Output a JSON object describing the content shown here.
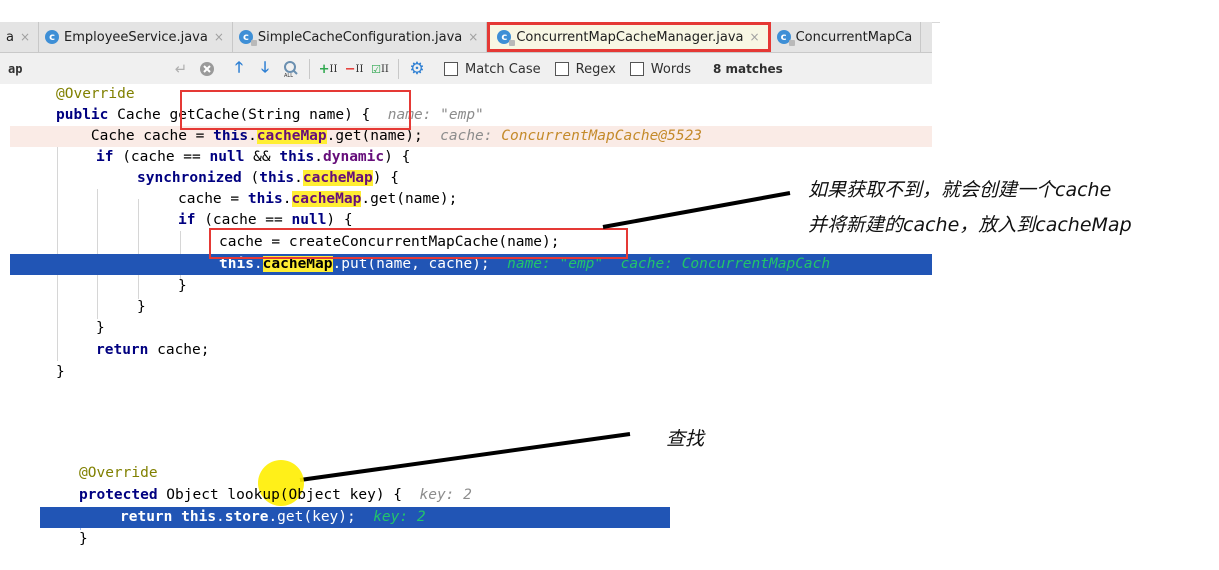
{
  "editor": {
    "tabs": [
      {
        "label": "a",
        "icon": "class-icon",
        "active": false
      },
      {
        "label": "EmployeeService.java",
        "icon": "class-icon",
        "active": false
      },
      {
        "label": "SimpleCacheConfiguration.java",
        "icon": "locked-class-icon",
        "active": false
      },
      {
        "label": "ConcurrentMapCacheManager.java",
        "icon": "locked-class-icon",
        "active": true
      },
      {
        "label": "ConcurrentMapCa",
        "icon": "locked-class-icon",
        "active": false
      }
    ],
    "close_glyph": "×",
    "find": {
      "query": "ap",
      "match_case_label": "Match Case",
      "regex_label": "Regex",
      "words_label": "Words",
      "match_count": "8 matches",
      "icons": [
        "enter-icon",
        "clear-icon",
        "prev-occurrence-icon",
        "next-occurrence-icon",
        "select-all-occurrences-icon",
        "add-selection-icon",
        "remove-selection-icon",
        "select-all-selection-icon",
        "settings-icon"
      ]
    },
    "code1": {
      "l1": "@Override",
      "l2_kw": "public",
      "l2_type": " Cache ",
      "l2_sig": "getCache(String name)",
      "l2_rest": " {  ",
      "l2_hint": "name: \"emp\"",
      "l3_a": "    Cache cache = ",
      "l3_this": "this",
      "l3_dot": ".",
      "l3_field": "cacheMap",
      "l3_b": ".get(name);  ",
      "l3_hint_label": "cache: ",
      "l3_hint_value": "ConcurrentMapCache@5523",
      "l4_if": "if",
      "l4_a": " (cache == ",
      "l4_null": "null",
      "l4_b": " && ",
      "l4_this": "this",
      "l4_field": "dynamic",
      "l4_c": ") {",
      "l5_sync": "synchronized",
      "l5_a": " (",
      "l5_this": "this",
      "l5_field": "cacheMap",
      "l5_b": ") {",
      "l6_a": "cache = ",
      "l6_this": "this",
      "l6_field": "cacheMap",
      "l6_b": ".get(name);",
      "l7_if": "if",
      "l7_a": " (cache == ",
      "l7_null": "null",
      "l7_b": ") {",
      "l8": "cache = createConcurrentMapCache(name);",
      "l9_this": "this",
      "l9_field": "cacheMap",
      "l9_a": ".put(name, cache);  ",
      "l9_hint": "name: \"emp\"  cache: ConcurrentMapCach",
      "brace": "}",
      "ret_kw": "return",
      "ret_rest": " cache;"
    },
    "code2": {
      "l1": "@Override",
      "l2_kw": "protected",
      "l2_a": " Object lookup(Object key) {  ",
      "l2_hint": "key: 2",
      "l3_ret": "return",
      "l3_this": "this",
      "l3_field": "store",
      "l3_a": ".get(key);  ",
      "l3_hint": "key: 2",
      "l4": "}"
    }
  },
  "annotations": {
    "note1_line1": "如果获取不到，就会创建一个cache",
    "note1_line2": "并将新建的cache，放入到cacheMap",
    "note2": "查找"
  },
  "colors": {
    "exec_line": "#2155b5",
    "highlight": "#ffee33",
    "callout_border": "#e53935",
    "keyword": "#000080"
  }
}
